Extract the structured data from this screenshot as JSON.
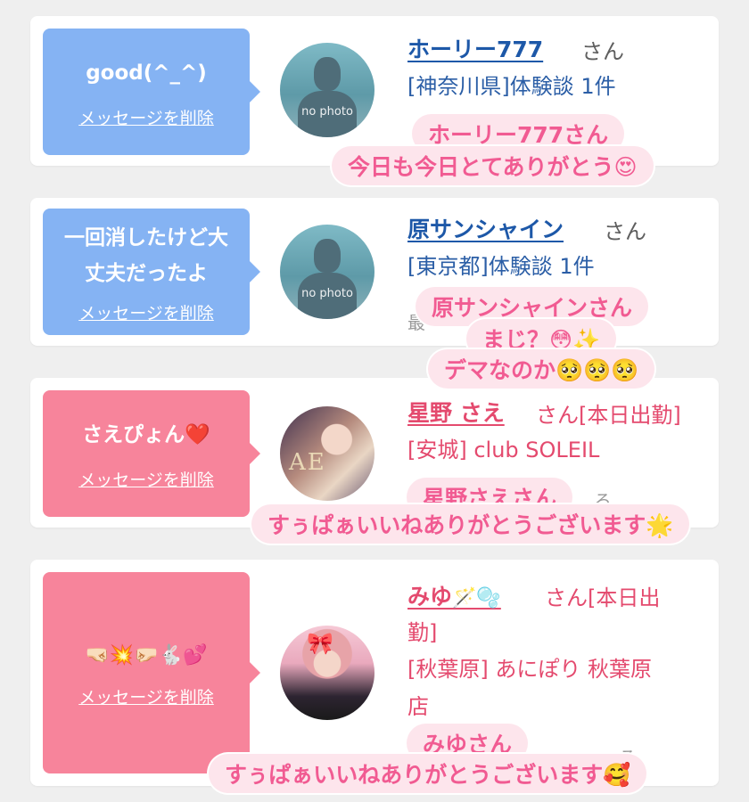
{
  "cards": [
    {
      "message": "good(^_^)",
      "delete_label": "メッセージを削除",
      "name": "ホーリー777",
      "san": "さん",
      "info_lines": [
        "[神奈川県]体験談 1件"
      ],
      "avatar_label": "no photo"
    },
    {
      "message_line1": "一回消したけど大",
      "message_line2": "丈夫だったよ",
      "delete_label": "メッセージを削除",
      "name": "原サンシャイン",
      "san": "さん",
      "info_lines": [
        "[東京都]体験談 1件"
      ],
      "avatar_label": "no photo",
      "ghost_text": "最"
    },
    {
      "message": "さえぴょん",
      "message_emoji": "❤️",
      "delete_label": "メッセージを削除",
      "name": "星野 さえ",
      "san": "さん[本日出勤]",
      "info_lines": [
        "[安城] club SOLEIL"
      ],
      "ghost_text": "ろ"
    },
    {
      "message": "🤜🏻💥🤛🏻🐇💕",
      "delete_label": "メッセージを削除",
      "name": "みゆ",
      "name_emoji": "🪄🫧",
      "san_line1": "さん[本日出",
      "san_line2": "勤]",
      "info_line1": "[秋葉原] あにぽり 秋葉原",
      "info_line2": "店",
      "ghost_text": "ろ"
    }
  ],
  "stickers": {
    "s1_line1": "ホーリー777さん",
    "s1_line2": "今日も今日とてありがとう😍",
    "s2_line1": "原サンシャインさん",
    "s2_line2": "まじ？😳✨",
    "s2_line3": "デマなのか🥺🥺🥺",
    "s3_line1": "星野さえさん",
    "s3_line2": "すぅぱぁいいねありがとうございます🌟",
    "s4_line1": "みゆさん",
    "s4_line2": "すぅぱぁいいねありがとうございます🥰"
  },
  "colors": {
    "blue_bubble": "#85b3f3",
    "pink_bubble": "#f7849b",
    "name_blue": "#1d58a8",
    "name_pink": "#e44a6e",
    "sticker_text": "#f15b92",
    "sticker_bg": "#fde5ec"
  }
}
